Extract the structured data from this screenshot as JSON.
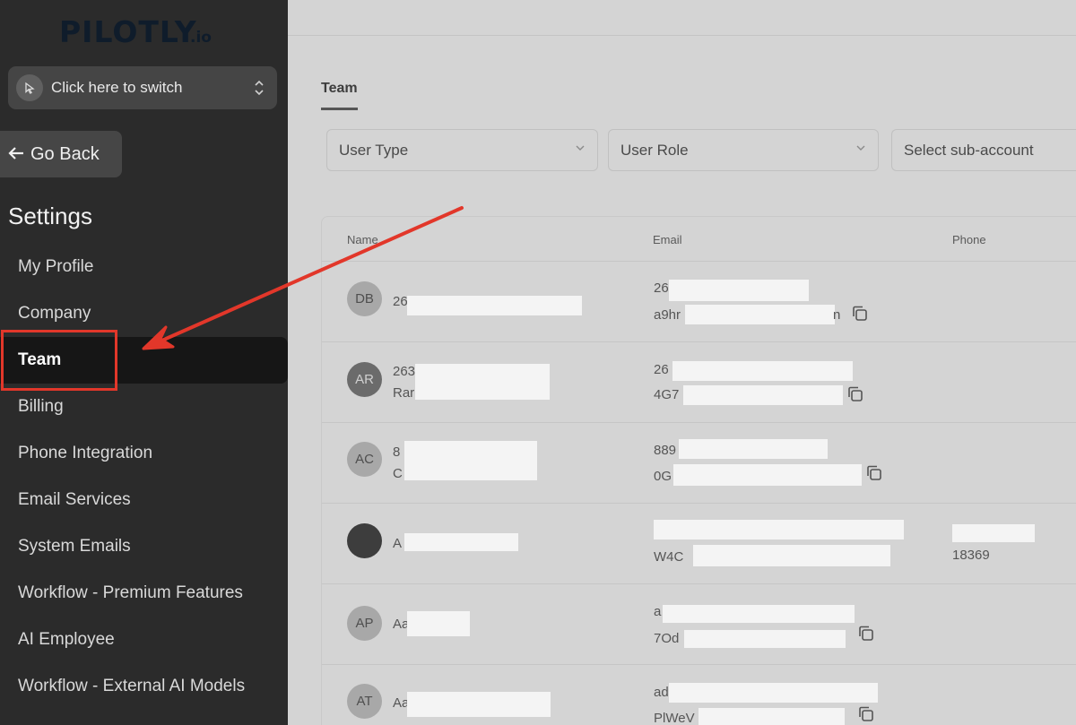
{
  "logo": {
    "name": "PILOTLY",
    "suffix": ".io"
  },
  "switcher": {
    "label": "Click here to switch"
  },
  "go_back": {
    "label": "Go Back"
  },
  "settings": {
    "title": "Settings"
  },
  "nav": {
    "items": [
      {
        "label": "My Profile"
      },
      {
        "label": "Company"
      },
      {
        "label": "Team"
      },
      {
        "label": "Billing"
      },
      {
        "label": "Phone Integration"
      },
      {
        "label": "Email Services"
      },
      {
        "label": "System Emails"
      },
      {
        "label": "Workflow - Premium Features"
      },
      {
        "label": "AI Employee"
      },
      {
        "label": "Workflow - External AI Models"
      }
    ],
    "active": "Team"
  },
  "tabs": {
    "team": "Team"
  },
  "filters": {
    "user_type": "User Type",
    "user_role": "User Role",
    "sub_account": "Select sub-account"
  },
  "table": {
    "columns": {
      "name": "Name",
      "email": "Email",
      "phone": "Phone"
    },
    "rows": [
      {
        "initials": "DB",
        "name1": "26",
        "name2": "",
        "email1": "26",
        "email2": "a9hr",
        "email2_tail": "n",
        "phone": ""
      },
      {
        "initials": "AR",
        "name1": "263",
        "name2": "Rar",
        "email1": "26",
        "email2": "4G7",
        "email2_tail": "",
        "phone": ""
      },
      {
        "initials": "AC",
        "name1": "8",
        "name2": "C",
        "email1": "889",
        "email2": "0G",
        "email2_tail": "",
        "phone": ""
      },
      {
        "initials": "",
        "name1": "A",
        "name2": "",
        "email1": "",
        "email2": "W4C",
        "email2_tail": "",
        "phone": "18369"
      },
      {
        "initials": "AP",
        "name1": "Aa",
        "name2": "",
        "email1": "a",
        "email2": "7Od",
        "email2_tail": "",
        "phone": ""
      },
      {
        "initials": "AT",
        "name1": "Aa",
        "name2": "",
        "email1": "ad",
        "email2": "PlWeV",
        "email2_tail": "",
        "phone": ""
      }
    ]
  },
  "colors": {
    "highlight": "#e2372a",
    "sidebar": "#2b2b2b",
    "active_item": "#161616"
  }
}
